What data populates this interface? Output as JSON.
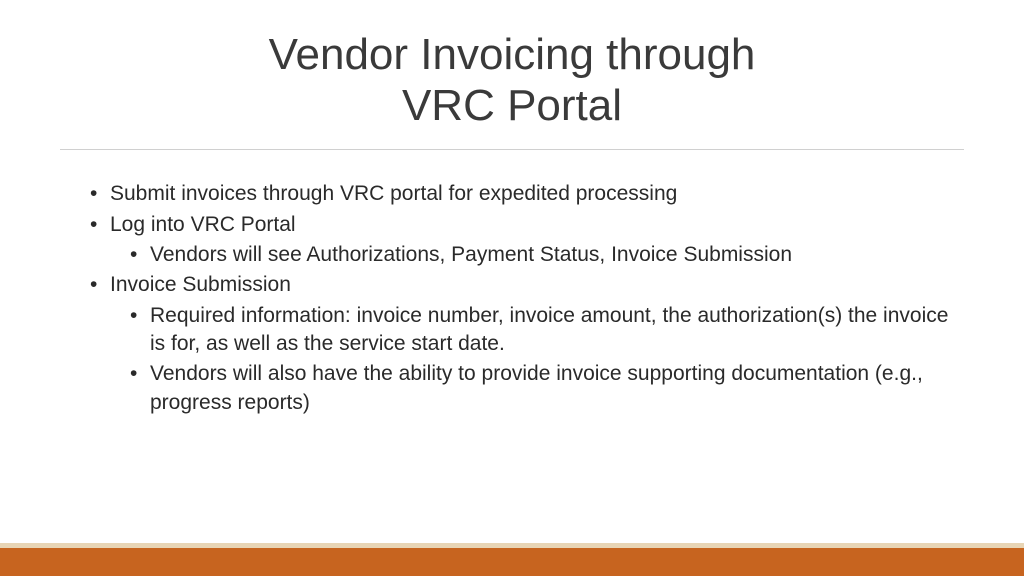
{
  "title_line1": "Vendor Invoicing through",
  "title_line2": "VRC Portal",
  "bullets": {
    "b1": "Submit invoices through VRC portal for expedited processing",
    "b2": "Log into VRC Portal",
    "b2_1": "Vendors will see Authorizations, Payment Status, Invoice Submission",
    "b3": "Invoice Submission",
    "b3_1": "Required information: invoice number, invoice amount, the authorization(s) the invoice is for, as well as the service start date.",
    "b3_2": "Vendors will also have the ability to provide invoice supporting documentation (e.g., progress reports)"
  },
  "colors": {
    "accent_orange": "#c7641f",
    "accent_tan": "#e8d5b5"
  }
}
